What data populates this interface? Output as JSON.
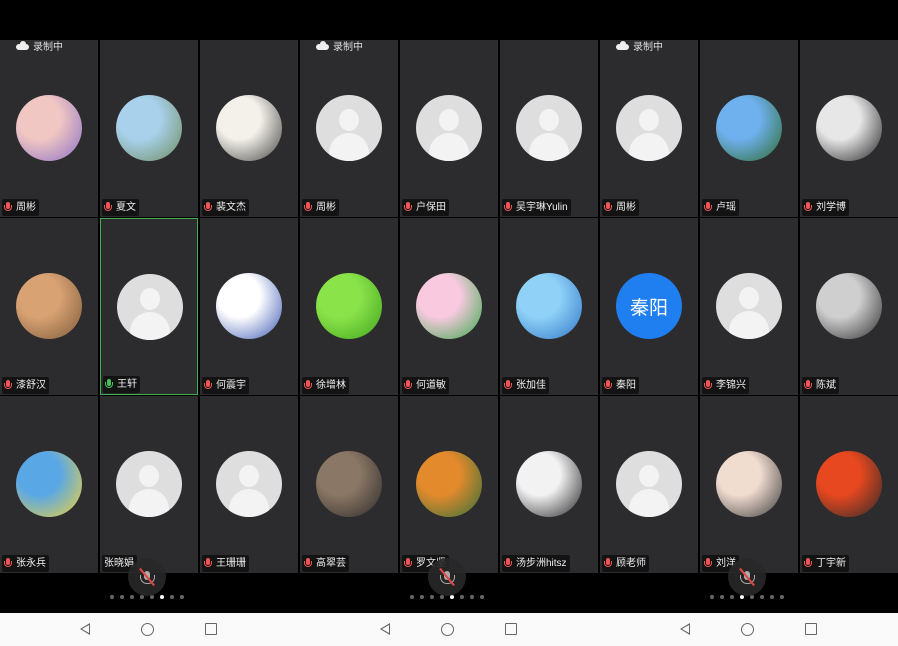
{
  "recording_label": "录制中",
  "panels": [
    {
      "tiles": [
        {
          "name": "周彬",
          "mic": "red",
          "avatar": "photo",
          "colors": [
            "#f1c7c3",
            "#8a6fc4"
          ]
        },
        {
          "name": "夏文",
          "mic": "red",
          "avatar": "photo",
          "colors": [
            "#a9d1ec",
            "#6d8d5f"
          ]
        },
        {
          "name": "裴文杰",
          "mic": "red",
          "avatar": "photo",
          "colors": [
            "#f4f1ea",
            "#444"
          ]
        },
        {
          "name": "漆舒汉",
          "mic": "red",
          "avatar": "photo",
          "colors": [
            "#d8a273",
            "#7c5a3a"
          ]
        },
        {
          "name": "王轩",
          "mic": "green",
          "avatar": "placeholder",
          "active": true
        },
        {
          "name": "何震宇",
          "mic": "red",
          "avatar": "photo",
          "colors": [
            "#ffffff",
            "#3a57b3"
          ]
        },
        {
          "name": "张永兵",
          "mic": "red",
          "avatar": "photo",
          "colors": [
            "#5aa7e6",
            "#f0d33a"
          ]
        },
        {
          "name": "张晓娟",
          "mic": "none",
          "avatar": "placeholder"
        },
        {
          "name": "王珊珊",
          "mic": "red",
          "avatar": "placeholder"
        }
      ],
      "active_dot": 5
    },
    {
      "tiles": [
        {
          "name": "周彬",
          "mic": "red",
          "avatar": "placeholder"
        },
        {
          "name": "户保田",
          "mic": "red",
          "avatar": "placeholder"
        },
        {
          "name": "吴宇琳Yulin",
          "mic": "red",
          "avatar": "placeholder"
        },
        {
          "name": "徐增林",
          "mic": "red",
          "avatar": "photo",
          "colors": [
            "#8be34a",
            "#3fa51c"
          ]
        },
        {
          "name": "何道敏",
          "mic": "red",
          "avatar": "photo",
          "colors": [
            "#f8c9df",
            "#38a84a"
          ]
        },
        {
          "name": "张加佳",
          "mic": "red",
          "avatar": "photo",
          "colors": [
            "#8fd1f7",
            "#2f77c8"
          ]
        },
        {
          "name": "高翠芸",
          "mic": "red",
          "avatar": "photo",
          "colors": [
            "#8a7765",
            "#2c2a28"
          ]
        },
        {
          "name": "罗文坚",
          "mic": "red",
          "avatar": "photo",
          "colors": [
            "#e38a2c",
            "#2e6f3a"
          ]
        },
        {
          "name": "汤步洲hitsz",
          "mic": "red",
          "avatar": "photo",
          "colors": [
            "#f2f2f2",
            "#222"
          ]
        }
      ],
      "active_dot": 4
    },
    {
      "tiles": [
        {
          "name": "周彬",
          "mic": "red",
          "avatar": "placeholder"
        },
        {
          "name": "卢瑶",
          "mic": "red",
          "avatar": "photo",
          "colors": [
            "#6fb0ef",
            "#2d6a2a"
          ]
        },
        {
          "name": "刘学博",
          "mic": "red",
          "avatar": "photo",
          "colors": [
            "#e7e7e7",
            "#222"
          ]
        },
        {
          "name": "秦阳",
          "mic": "red",
          "avatar": "initials",
          "initials": "秦阳"
        },
        {
          "name": "李锦兴",
          "mic": "red",
          "avatar": "placeholder"
        },
        {
          "name": "陈斌",
          "mic": "red",
          "avatar": "photo",
          "colors": [
            "#cfcfcf",
            "#2e2e2e"
          ]
        },
        {
          "name": "顾老师",
          "mic": "red",
          "avatar": "placeholder"
        },
        {
          "name": "刘洋",
          "mic": "red",
          "avatar": "photo",
          "colors": [
            "#f1dcd0",
            "#3a3a3a"
          ]
        },
        {
          "name": "丁宇新",
          "mic": "red",
          "avatar": "photo",
          "colors": [
            "#e8481f",
            "#2a2a2a"
          ]
        }
      ],
      "active_dot": 3
    }
  ],
  "icons": {
    "mute": "mic-muted-icon",
    "back": "back-triangle-icon",
    "home": "home-circle-icon",
    "recent": "recent-square-icon",
    "cloud": "cloud-icon"
  }
}
